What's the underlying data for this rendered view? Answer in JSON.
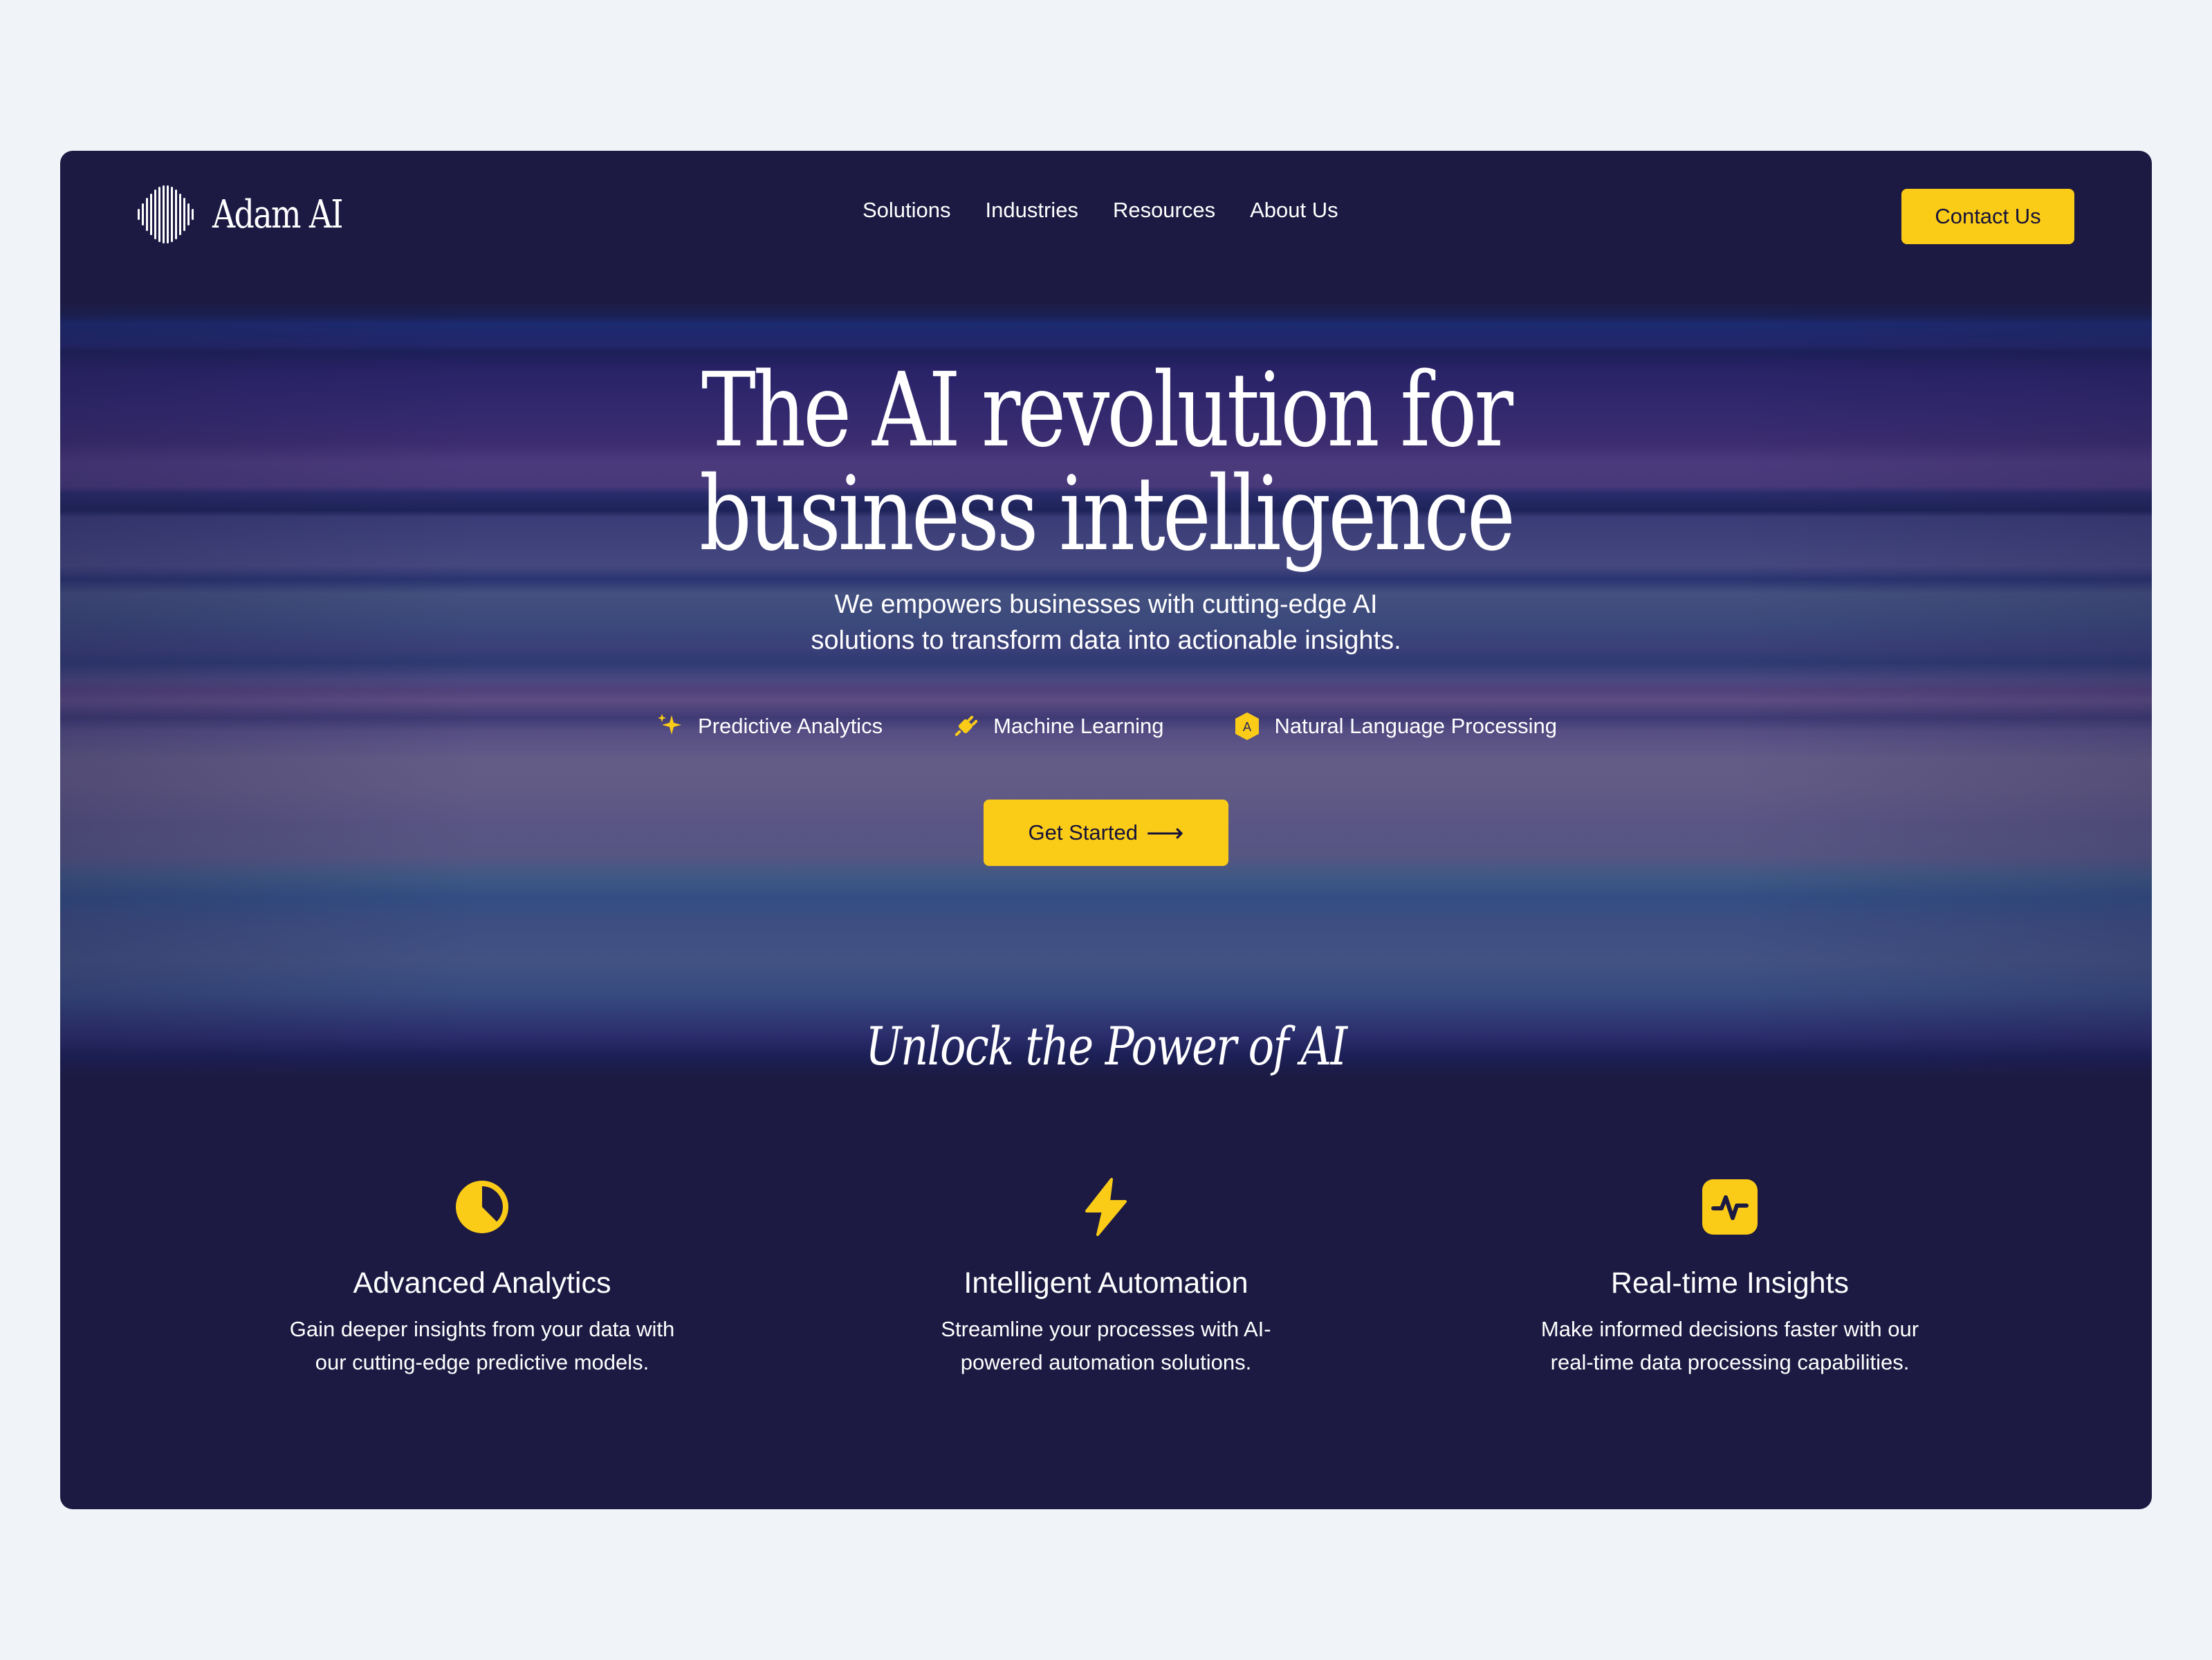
{
  "brand": {
    "name": "Adam AI"
  },
  "nav": {
    "links": [
      "Solutions",
      "Industries",
      "Resources",
      "About Us"
    ],
    "contact_label": "Contact Us"
  },
  "hero": {
    "title_line1": "The AI revolution for",
    "title_line2": "business intelligence",
    "subtitle_line1": "We empowers businesses with cutting-edge AI",
    "subtitle_line2": "solutions to transform data into actionable insights.",
    "features": [
      {
        "label": "Predictive Analytics",
        "icon": "sparkle-icon"
      },
      {
        "label": "Machine Learning",
        "icon": "plug-icon"
      },
      {
        "label": "Natural Language Processing",
        "icon": "language-badge-icon",
        "badge_text": "A"
      }
    ],
    "cta_label": "Get Started",
    "cta_arrow": "⟶"
  },
  "section": {
    "title": "Unlock the Power of AI",
    "cards": [
      {
        "icon": "pie-chart-icon",
        "title": "Advanced Analytics",
        "desc_line1": "Gain deeper insights from your data with",
        "desc_line2": "our cutting-edge predictive models."
      },
      {
        "icon": "lightning-icon",
        "title": "Intelligent Automation",
        "desc_line1": "Streamline your processes with AI-",
        "desc_line2": "powered automation solutions."
      },
      {
        "icon": "activity-icon",
        "title": "Real-time Insights",
        "desc_line1": "Make informed decisions faster with our",
        "desc_line2": "real-time data processing capabilities."
      }
    ]
  },
  "colors": {
    "accent": "#fbcc17",
    "card_bg": "#1c1a42",
    "page_bg": "#f0f3f8"
  }
}
